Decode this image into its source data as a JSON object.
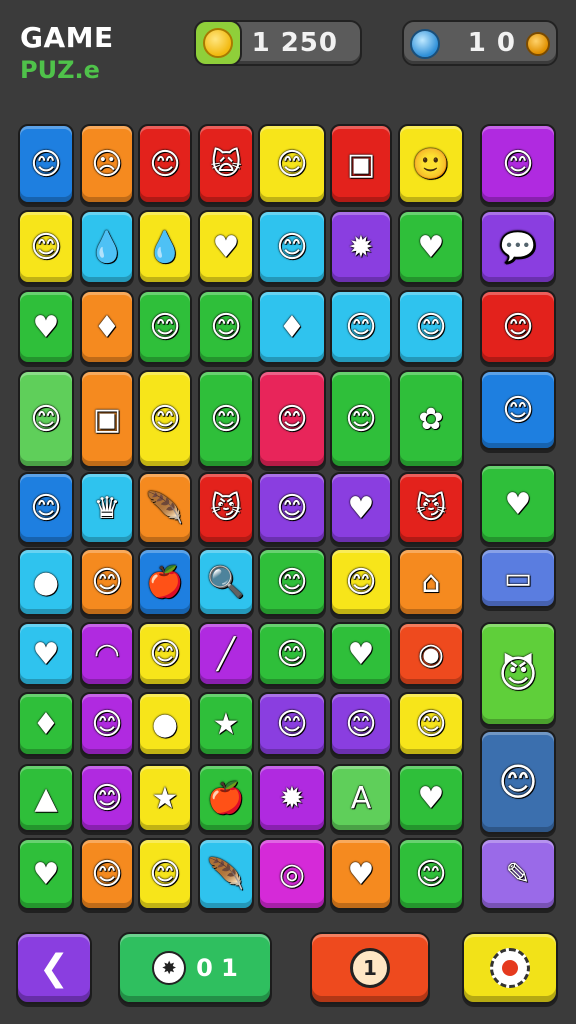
{
  "header": {
    "title_line1": "GAME",
    "title_line2": "PUZ.e",
    "score": "1 250",
    "gems": "1 0",
    "score_icon": "coin-icon",
    "gems_icon": "gem-icon"
  },
  "bottom_bar": {
    "back_icon": "chevron-left-icon",
    "hint_count": "0 1",
    "hint_icon": "hedgehog-icon",
    "coin_icon": "coin-icon",
    "settings_icon": "gear-icon"
  },
  "grid": {
    "rows": [
      [
        {
          "c": "#1e7fe0",
          "i": "😊",
          "n": "gnome-face"
        },
        {
          "c": "#f58a1f",
          "i": "☹",
          "n": "ghost-face"
        },
        {
          "c": "#e3221c",
          "i": "😊",
          "n": "cat-face"
        },
        {
          "c": "#e3221c",
          "i": "🙀",
          "n": "wolf-face"
        },
        {
          "c": "#f7e51a",
          "i": "😊",
          "n": "bear-face"
        },
        {
          "c": "#e3221c",
          "i": "▣",
          "n": "card"
        },
        {
          "c": "#f7e51a",
          "i": "🙂",
          "n": "green-drop"
        },
        {
          "c": "#b02ae0",
          "i": "😊",
          "n": "gnome-face"
        }
      ],
      [
        {
          "c": "#f7e51a",
          "i": "😊",
          "n": "goblin-face"
        },
        {
          "c": "#2fc3ee",
          "i": "💧",
          "n": "drop"
        },
        {
          "c": "#f7e51a",
          "i": "💧",
          "n": "leaf"
        },
        {
          "c": "#f7e51a",
          "i": "♥",
          "n": "heart"
        },
        {
          "c": "#2fc3ee",
          "i": "😊",
          "n": "cat-face"
        },
        {
          "c": "#8a3ee0",
          "i": "✹",
          "n": "spiky"
        },
        {
          "c": "#2fbf3a",
          "i": "♥",
          "n": "heart"
        },
        {
          "c": "#8a3ee0",
          "i": "💬",
          "n": "speech-bubble"
        }
      ],
      [
        {
          "c": "#2fbf3a",
          "i": "♥",
          "n": "heart"
        },
        {
          "c": "#f58a1f",
          "i": "♦",
          "n": "diamond"
        },
        {
          "c": "#2fbf3a",
          "i": "😊",
          "n": "flame-face"
        },
        {
          "c": "#2fbf3a",
          "i": "😊",
          "n": "leaf-face"
        },
        {
          "c": "#2fc3ee",
          "i": "♦",
          "n": "diamond"
        },
        {
          "c": "#2fc3ee",
          "i": "😊",
          "n": "pineapple-face"
        },
        {
          "c": "#2fc3ee",
          "i": "😊",
          "n": "cat-face"
        },
        {
          "c": "#e3221c",
          "i": "😊",
          "n": "flower-face"
        }
      ],
      [
        {
          "c": "#5fcf5a",
          "i": "😊",
          "n": "drop-face"
        },
        {
          "c": "#f58a1f",
          "i": "▣",
          "n": "card"
        },
        {
          "c": "#f7e51a",
          "i": "😊",
          "n": "leaf-face"
        },
        {
          "c": "#2fbf3a",
          "i": "😊",
          "n": "flame-face"
        },
        {
          "c": "#e8255a",
          "i": "😊",
          "n": "gnome-face"
        },
        {
          "c": "#2fbf3a",
          "i": "😊",
          "n": "bunny-face"
        },
        {
          "c": "#2fbf3a",
          "i": "✿",
          "n": "flower"
        },
        {
          "c": "#1e7fe0",
          "i": "😊",
          "n": "crown-face"
        }
      ],
      [
        {
          "c": "#1e7fe0",
          "i": "😊",
          "n": "fox-face"
        },
        {
          "c": "#2fc3ee",
          "i": "♛",
          "n": "crown"
        },
        {
          "c": "#f58a1f",
          "i": "🪶",
          "n": "feather"
        },
        {
          "c": "#e3221c",
          "i": "😼",
          "n": "cat-face"
        },
        {
          "c": "#8a3ee0",
          "i": "😊",
          "n": "crown-face"
        },
        {
          "c": "#8a3ee0",
          "i": "♥",
          "n": "heart"
        },
        {
          "c": "#e3221c",
          "i": "😼",
          "n": "wolf-face"
        },
        {
          "c": "#2fbf3a",
          "i": "♥",
          "n": "heart"
        }
      ],
      [
        {
          "c": "#2fc3ee",
          "i": "●",
          "n": "ball"
        },
        {
          "c": "#f58a1f",
          "i": "😊",
          "n": "cat-face"
        },
        {
          "c": "#1e7fe0",
          "i": "🍎",
          "n": "apple"
        },
        {
          "c": "#2fc3ee",
          "i": "🔍",
          "n": "magnifier"
        },
        {
          "c": "#2fbf3a",
          "i": "😊",
          "n": "crab-face"
        },
        {
          "c": "#f7e51a",
          "i": "😊",
          "n": "crab-face"
        },
        {
          "c": "#f58a1f",
          "i": "⌂",
          "n": "arch"
        },
        {
          "c": "#5a7de0",
          "i": "▭",
          "n": "panel"
        }
      ],
      [
        {
          "c": "#2fc3ee",
          "i": "♥",
          "n": "heart"
        },
        {
          "c": "#b02ae0",
          "i": "◠",
          "n": "signal"
        },
        {
          "c": "#f7e51a",
          "i": "😊",
          "n": "bear-face"
        },
        {
          "c": "#b02ae0",
          "i": "╱",
          "n": "slash"
        },
        {
          "c": "#2fbf3a",
          "i": "😊",
          "n": "bear-face"
        },
        {
          "c": "#2fbf3a",
          "i": "♥",
          "n": "heart"
        },
        {
          "c": "#ee4a1e",
          "i": "◉",
          "n": "eye"
        },
        {
          "c": "#5fcf3a",
          "i": "😈",
          "n": "gnome-face"
        }
      ],
      [
        {
          "c": "#2fbf3a",
          "i": "♦",
          "n": "diamond"
        },
        {
          "c": "#b02ae0",
          "i": "😊",
          "n": "cat-face"
        },
        {
          "c": "#f7e51a",
          "i": "●",
          "n": "donut"
        },
        {
          "c": "#2fbf3a",
          "i": "★",
          "n": "star"
        },
        {
          "c": "#8a3ee0",
          "i": "😊",
          "n": "cat-face"
        },
        {
          "c": "#8a3ee0",
          "i": "😊",
          "n": "wolf-face"
        },
        {
          "c": "#f7e51a",
          "i": "😊",
          "n": "frog-face"
        },
        {
          "c": "#3b6fae",
          "i": "😊",
          "n": "cat-face"
        }
      ],
      [
        {
          "c": "#2fbf3a",
          "i": "▲",
          "n": "spike"
        },
        {
          "c": "#b02ae0",
          "i": "😊",
          "n": "sun-face"
        },
        {
          "c": "#f7e51a",
          "i": "★",
          "n": "star"
        },
        {
          "c": "#2fbf3a",
          "i": "🍎",
          "n": "apple"
        },
        {
          "c": "#b02ae0",
          "i": "✹",
          "n": "spiky"
        },
        {
          "c": "#5fcf5a",
          "i": "A",
          "n": "letter"
        },
        {
          "c": "#2fbf3a",
          "i": "♥",
          "n": "heart"
        }
      ],
      [
        {
          "c": "#2fbf3a",
          "i": "♥",
          "n": "heart"
        },
        {
          "c": "#f58a1f",
          "i": "😊",
          "n": "flame-face"
        },
        {
          "c": "#f7e51a",
          "i": "😊",
          "n": "star-face"
        },
        {
          "c": "#2fc3ee",
          "i": "🪶",
          "n": "feather"
        },
        {
          "c": "#d52ad8",
          "i": "◎",
          "n": "blob"
        },
        {
          "c": "#f58a1f",
          "i": "♥",
          "n": "heart"
        },
        {
          "c": "#2fbf3a",
          "i": "😊",
          "n": "shell"
        },
        {
          "c": "#9a6ae8",
          "i": "✎",
          "n": "pencil"
        }
      ]
    ]
  }
}
